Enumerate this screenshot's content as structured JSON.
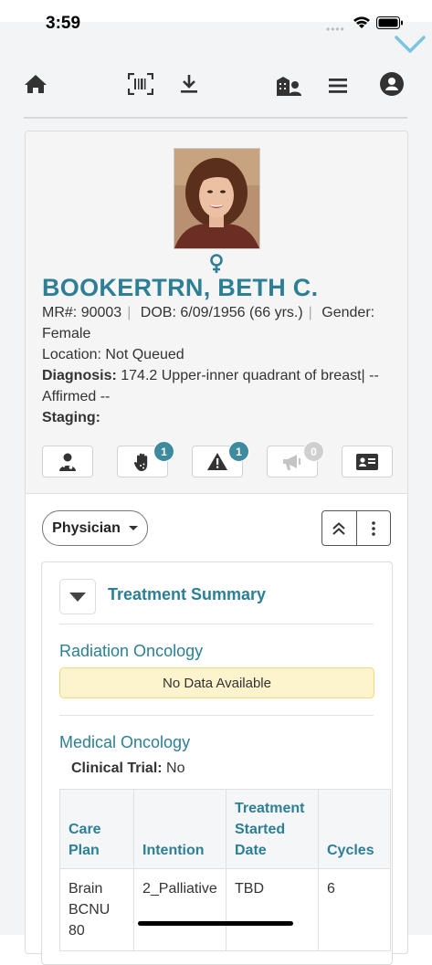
{
  "status_bar": {
    "time": "3:59",
    "signal_dots": "••••"
  },
  "toolbar": {
    "icons": [
      "home-icon",
      "barcode-scan-icon",
      "download-icon",
      "facility-users-icon",
      "menu-icon",
      "user-account-icon"
    ]
  },
  "patient": {
    "name": "BOOKERTRN, BETH C.",
    "gender_symbol": "♀",
    "mr_label": "MR#:",
    "mr_value": "90003",
    "dob_label": "DOB:",
    "dob_value": "6/09/1956 (66 yrs.)",
    "gender_label": "Gender:",
    "gender_value": "Female",
    "location_label": "Location:",
    "location_value": "Not Queued",
    "diagnosis_label": "Diagnosis:",
    "diagnosis_value": "174.2 Upper-inner quadrant of breast| --",
    "diagnosis_status": "Affirmed --",
    "staging_label": "Staging:"
  },
  "flags": [
    {
      "icon": "physician-icon",
      "count": null
    },
    {
      "icon": "allergy-hand-icon",
      "count": "1"
    },
    {
      "icon": "warning-icon",
      "count": "1"
    },
    {
      "icon": "announcement-icon",
      "count": "0"
    },
    {
      "icon": "id-card-icon",
      "count": null
    }
  ],
  "role_dropdown": {
    "selected": "Physician"
  },
  "summary": {
    "title": "Treatment Summary",
    "radiation": {
      "heading": "Radiation Oncology",
      "empty_text": "No Data Available"
    },
    "medical": {
      "heading": "Medical Oncology",
      "clinical_trial_label": "Clinical Trial:",
      "clinical_trial_value": "No",
      "columns": [
        "Care Plan",
        "Intention",
        "Treatment Started Date",
        "Cycles"
      ],
      "rows": [
        {
          "care_plan": "Brain BCNU 80",
          "intention": "2_Palliative",
          "started": "TBD",
          "cycles": "6"
        }
      ]
    }
  },
  "colors": {
    "accent": "#2c7f95",
    "badge": "#3d8b9c",
    "warning_bg": "#fdf3cd"
  }
}
